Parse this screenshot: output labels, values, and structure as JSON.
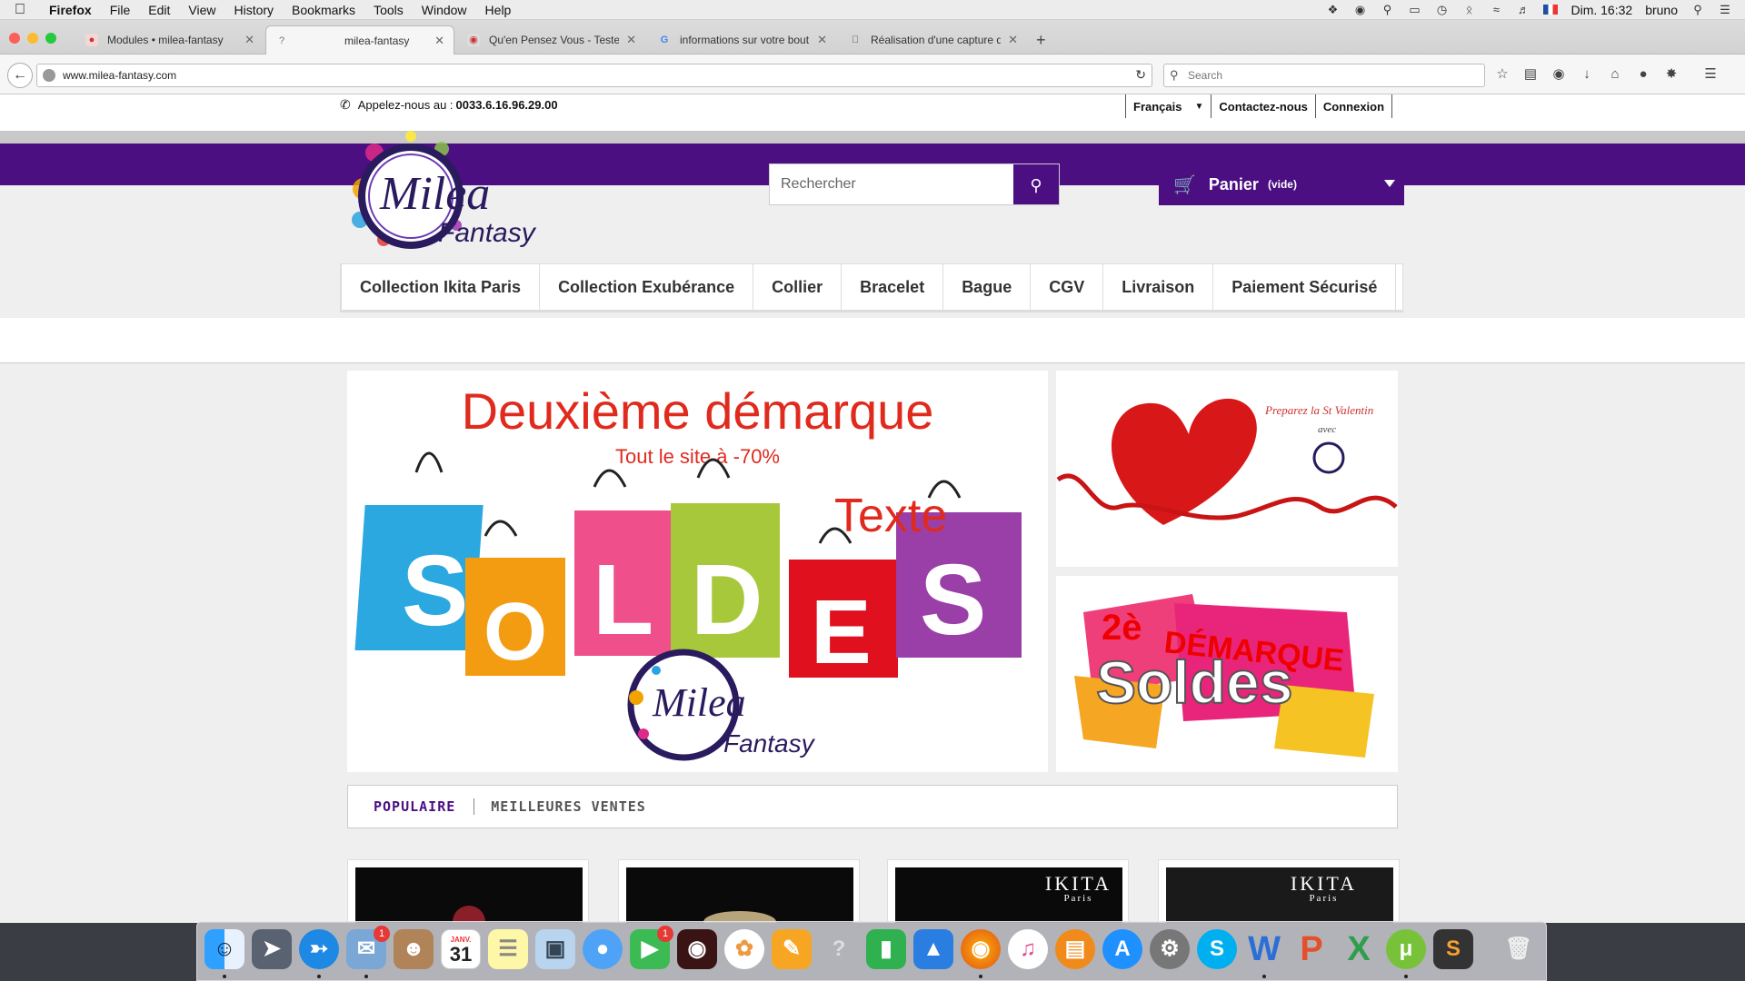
{
  "menubar": {
    "app": "Firefox",
    "items": [
      "File",
      "Edit",
      "View",
      "History",
      "Bookmarks",
      "Tools",
      "Window",
      "Help"
    ],
    "clock": "Dim. 16:32",
    "user": "bruno"
  },
  "tabs": [
    {
      "title": "Modules • milea-fantasy"
    },
    {
      "title": "milea-fantasy"
    },
    {
      "title": "Qu'en Pensez Vous - Teste..."
    },
    {
      "title": "informations sur votre bout..."
    },
    {
      "title": "Réalisation d'une capture d..."
    }
  ],
  "nav": {
    "url": "www.milea-fantasy.com",
    "search_placeholder": "Search"
  },
  "site": {
    "phone_label": "Appelez-nous au :",
    "phone_number": "0033.6.16.96.29.00",
    "top_links": [
      "Français",
      "Contactez-nous",
      "Connexion"
    ],
    "logo_text_1": "Milea",
    "logo_text_2": "Fantasy",
    "search_placeholder": "Rechercher",
    "cart_label": "Panier",
    "cart_status": "(vide)",
    "menu": [
      "Collection Ikita Paris",
      "Collection Exubérance",
      "Collier",
      "Bracelet",
      "Bague",
      "CGV",
      "Livraison",
      "Paiement Sécurisé"
    ],
    "banner": {
      "title": "Deuxième démarque",
      "subtitle": "Tout le site à -70%",
      "soldes": "SOLDES",
      "overlay": "Texte"
    },
    "side1": {
      "line1": "Preparez la St Valentin",
      "line2": "avec"
    },
    "side2": {
      "num": "2è",
      "word": "DÉMARQUE",
      "soldes": "Soldes"
    },
    "product_tabs": [
      "POPULAIRE",
      "MEILLEURES VENTES"
    ],
    "product_brand": "IKITA",
    "product_brand_sub": "Paris"
  },
  "colors": {
    "purple": "#4b0f82",
    "red": "#e02a1e"
  },
  "dock": [
    "finder-icon",
    "launchpad-icon",
    "safari-icon",
    "mail-icon",
    "contacts-icon",
    "calendar-icon",
    "notes-icon",
    "preview-icon",
    "messages-icon",
    "facetime-icon",
    "photobooth-icon",
    "photos-icon",
    "pages-icon",
    "help-icon",
    "numbers-icon",
    "keynote-icon",
    "firefox-icon",
    "itunes-icon",
    "ibooks-icon",
    "appstore-icon",
    "system-preferences-icon",
    "skype-icon",
    "word-icon",
    "powerpoint-icon",
    "excel-icon",
    "utorrent-icon",
    "sublime-icon",
    "trash-icon"
  ],
  "dock_badges": {
    "mail": "1",
    "facetime": "1"
  },
  "calendar": {
    "month": "JANV.",
    "day": "31"
  }
}
